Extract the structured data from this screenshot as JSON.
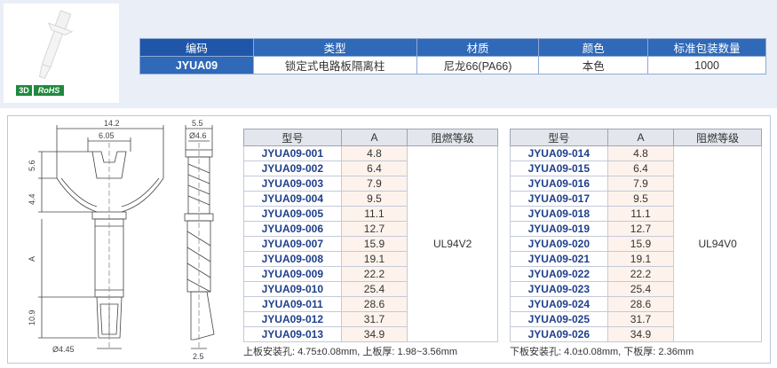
{
  "badges": {
    "three_d": "3D",
    "rohs": "RoHS"
  },
  "spec": {
    "headers": [
      "编码",
      "类型",
      "材质",
      "颜色",
      "标准包装数量"
    ],
    "row": [
      "JYUA09",
      "锁定式电路板隔离柱",
      "尼龙66(PA66)",
      "本色",
      "1000"
    ]
  },
  "drawing": {
    "top_width": "14.2",
    "inner_width": "6.05",
    "upper_h": "5.6",
    "mid_h": "4.4",
    "a_label": "A",
    "lower_h": "10.9",
    "bottom_dia": "Ø4.45",
    "side_top": "5.5",
    "side_dia": "Ø4.6",
    "side_bottom": "2.5"
  },
  "table_headers": [
    "型号",
    "A",
    "阻燃等级"
  ],
  "table1": {
    "grade": "UL94V2",
    "rows": [
      [
        "JYUA09-001",
        "4.8"
      ],
      [
        "JYUA09-002",
        "6.4"
      ],
      [
        "JYUA09-003",
        "7.9"
      ],
      [
        "JYUA09-004",
        "9.5"
      ],
      [
        "JYUA09-005",
        "11.1"
      ],
      [
        "JYUA09-006",
        "12.7"
      ],
      [
        "JYUA09-007",
        "15.9"
      ],
      [
        "JYUA09-008",
        "19.1"
      ],
      [
        "JYUA09-009",
        "22.2"
      ],
      [
        "JYUA09-010",
        "25.4"
      ],
      [
        "JYUA09-011",
        "28.6"
      ],
      [
        "JYUA09-012",
        "31.7"
      ],
      [
        "JYUA09-013",
        "34.9"
      ]
    ],
    "note": "上板安装孔: 4.75±0.08mm, 上板厚: 1.98~3.56mm"
  },
  "table2": {
    "grade": "UL94V0",
    "rows": [
      [
        "JYUA09-014",
        "4.8"
      ],
      [
        "JYUA09-015",
        "6.4"
      ],
      [
        "JYUA09-016",
        "7.9"
      ],
      [
        "JYUA09-017",
        "9.5"
      ],
      [
        "JYUA09-018",
        "11.1"
      ],
      [
        "JYUA09-019",
        "12.7"
      ],
      [
        "JYUA09-020",
        "15.9"
      ],
      [
        "JYUA09-021",
        "19.1"
      ],
      [
        "JYUA09-022",
        "22.2"
      ],
      [
        "JYUA09-023",
        "25.4"
      ],
      [
        "JYUA09-024",
        "28.6"
      ],
      [
        "JYUA09-025",
        "31.7"
      ],
      [
        "JYUA09-026",
        "34.9"
      ]
    ],
    "note": "下板安装孔: 4.0±0.08mm, 下板厚: 2.36mm"
  }
}
